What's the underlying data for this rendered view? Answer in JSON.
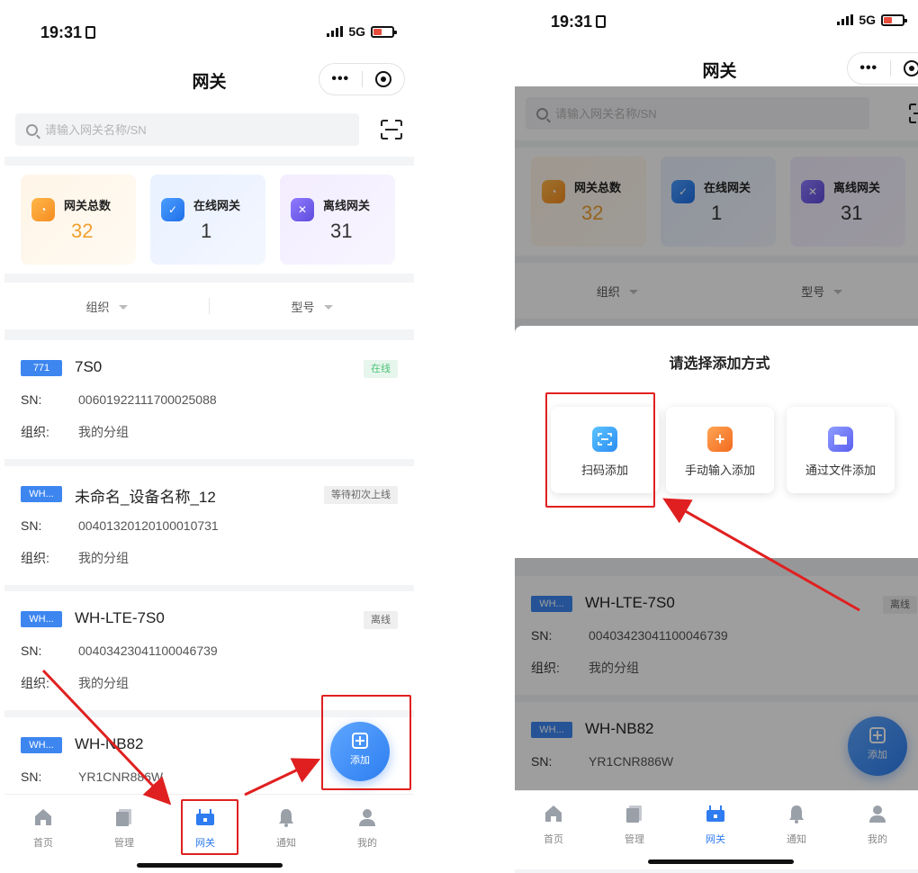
{
  "status": {
    "time": "19:31",
    "network": "5G"
  },
  "nav": {
    "title": "网关",
    "more": "•••"
  },
  "search": {
    "placeholder": "请输入网关名称/SN"
  },
  "stats": [
    {
      "label": "网关总数",
      "value": "32"
    },
    {
      "label": "在线网关",
      "value": "1"
    },
    {
      "label": "离线网关",
      "value": "31"
    }
  ],
  "filters": {
    "org": "组织",
    "model": "型号"
  },
  "devices": [
    {
      "tag": "771",
      "name": "7S0",
      "status": "在线",
      "sn_label": "SN:",
      "sn": "00601922111700025088",
      "org_label": "组织:",
      "org": "我的分组"
    },
    {
      "tag": "WH...",
      "name": "未命名_设备名称_12",
      "status": "等待初次上线",
      "sn_label": "SN:",
      "sn": "00401320120100010731",
      "org_label": "组织:",
      "org": "我的分组"
    },
    {
      "tag": "WH...",
      "name": "WH-LTE-7S0",
      "status": "离线",
      "sn_label": "SN:",
      "sn": "00403423041100046739",
      "org_label": "组织:",
      "org": "我的分组"
    },
    {
      "tag": "WH...",
      "name": "WH-NB82",
      "sn_label": "SN:",
      "sn": "YR1CNR886W"
    }
  ],
  "fab": {
    "label": "添加"
  },
  "tabs": [
    {
      "label": "首页"
    },
    {
      "label": "管理"
    },
    {
      "label": "网关"
    },
    {
      "label": "通知"
    },
    {
      "label": "我的"
    }
  ],
  "sheet": {
    "title": "请选择添加方式",
    "options": [
      {
        "label": "扫码添加",
        "icon": "scan-icon"
      },
      {
        "label": "手动输入添加",
        "icon": "plus-icon"
      },
      {
        "label": "通过文件添加",
        "icon": "folder-icon"
      }
    ]
  },
  "colors": {
    "accent": "#2f7cf0",
    "highlight": "#e02020",
    "online": "#4cc278"
  }
}
